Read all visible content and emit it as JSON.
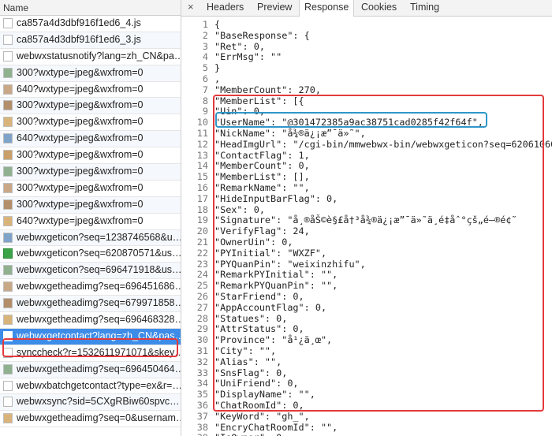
{
  "left_panel": {
    "header": "Name",
    "requests": [
      {
        "name": "ca857a4d3dbf916f1ed6_4.js",
        "icon": "file-icon"
      },
      {
        "name": "ca857a4d3dbf916f1ed6_3.js",
        "icon": "file-icon"
      },
      {
        "name": "webwxstatusnotify?lang=zh_CN&pa…",
        "icon": "file-icon"
      },
      {
        "name": "300?wxtype=jpeg&wxfrom=0",
        "icon": "image-icon"
      },
      {
        "name": "640?wxtype=jpeg&wxfrom=0",
        "icon": "image-icon"
      },
      {
        "name": "300?wxtype=jpeg&wxfrom=0",
        "icon": "image-icon"
      },
      {
        "name": "300?wxtype=jpeg&wxfrom=0",
        "icon": "image-icon"
      },
      {
        "name": "640?wxtype=jpeg&wxfrom=0",
        "icon": "image-icon"
      },
      {
        "name": "300?wxtype=jpeg&wxfrom=0",
        "icon": "image-icon"
      },
      {
        "name": "300?wxtype=jpeg&wxfrom=0",
        "icon": "image-icon"
      },
      {
        "name": "300?wxtype=jpeg&wxfrom=0",
        "icon": "image-icon"
      },
      {
        "name": "300?wxtype=jpeg&wxfrom=0",
        "icon": "image-icon"
      },
      {
        "name": "640?wxtype=jpeg&wxfrom=0",
        "icon": "image-icon"
      },
      {
        "name": "webwxgeticon?seq=1238746568&u…",
        "icon": "image-icon"
      },
      {
        "name": "webwxgeticon?seq=620870571&us…",
        "icon": "image-icon-green"
      },
      {
        "name": "webwxgeticon?seq=696471918&us…",
        "icon": "image-icon"
      },
      {
        "name": "webwxgetheadimg?seq=696451686…",
        "icon": "image-icon"
      },
      {
        "name": "webwxgetheadimg?seq=679971858…",
        "icon": "image-icon"
      },
      {
        "name": "webwxgetheadimg?seq=696468328…",
        "icon": "image-icon"
      },
      {
        "name": "webwxgetcontact?lang=zh_CN&pas…",
        "icon": "file-icon",
        "selected": true
      },
      {
        "name": "synccheck?r=1532611971071&skey…",
        "icon": "file-icon"
      },
      {
        "name": "webwxgetheadimg?seq=696450464…",
        "icon": "image-icon"
      },
      {
        "name": "webwxbatchgetcontact?type=ex&r=…",
        "icon": "file-icon"
      },
      {
        "name": "webwxsync?sid=5CXgRBiw60spvc…",
        "icon": "file-icon"
      },
      {
        "name": "webwxgetheadimg?seq=0&usernam…",
        "icon": "image-icon"
      }
    ]
  },
  "detail": {
    "close_icon": "×",
    "tabs": [
      "Headers",
      "Preview",
      "Response",
      "Cookies",
      "Timing"
    ],
    "active_tab": "Response",
    "lines": [
      {
        "n": "1",
        "t": "{"
      },
      {
        "n": "2",
        "t": "\"BaseResponse\": {"
      },
      {
        "n": "3",
        "t": "\"Ret\": 0,"
      },
      {
        "n": "4",
        "t": "\"ErrMsg\": \"\""
      },
      {
        "n": "5",
        "t": "}"
      },
      {
        "n": "6",
        "t": ","
      },
      {
        "n": "7",
        "t": "\"MemberCount\": 270,"
      },
      {
        "n": "8",
        "t": "\"MemberList\": [{"
      },
      {
        "n": "9",
        "t": "\"Uin\": 0,"
      },
      {
        "n": "10",
        "t": "\"UserName\": \"@301472385a9ac38751cad0285f42f64f\","
      },
      {
        "n": "11",
        "t": "\"NickName\": \"å¾®ä¿¡æ”¯ä»˜\","
      },
      {
        "n": "12",
        "t": "\"HeadImgUrl\": \"/cgi-bin/mmwebwx-bin/webwxgeticon?seq=620610606"
      },
      {
        "n": "13",
        "t": "\"ContactFlag\": 1,"
      },
      {
        "n": "14",
        "t": "\"MemberCount\": 0,"
      },
      {
        "n": "15",
        "t": "\"MemberList\": [],"
      },
      {
        "n": "16",
        "t": "\"RemarkName\": \"\","
      },
      {
        "n": "17",
        "t": "\"HideInputBarFlag\": 0,"
      },
      {
        "n": "18",
        "t": "\"Sex\": 0,"
      },
      {
        "n": "19",
        "t": "\"Signature\": \"å¸®åŠ©è§£å†³å¾®ä¿¡æ”¯ä»˜ä¸­é‡åˆ°çš„é—®é¢˜"
      },
      {
        "n": "20",
        "t": "\"VerifyFlag\": 24,"
      },
      {
        "n": "21",
        "t": "\"OwnerUin\": 0,"
      },
      {
        "n": "22",
        "t": "\"PYInitial\": \"WXZF\","
      },
      {
        "n": "23",
        "t": "\"PYQuanPin\": \"weixinzhifu\","
      },
      {
        "n": "24",
        "t": "\"RemarkPYInitial\": \"\","
      },
      {
        "n": "25",
        "t": "\"RemarkPYQuanPin\": \"\","
      },
      {
        "n": "26",
        "t": "\"StarFriend\": 0,"
      },
      {
        "n": "27",
        "t": "\"AppAccountFlag\": 0,"
      },
      {
        "n": "28",
        "t": "\"Statues\": 0,"
      },
      {
        "n": "29",
        "t": "\"AttrStatus\": 0,"
      },
      {
        "n": "30",
        "t": "\"Province\": \"å¹¿ä¸œ\","
      },
      {
        "n": "31",
        "t": "\"City\": \"\","
      },
      {
        "n": "32",
        "t": "\"Alias\": \"\","
      },
      {
        "n": "33",
        "t": "\"SnsFlag\": 0,"
      },
      {
        "n": "34",
        "t": "\"UniFriend\": 0,"
      },
      {
        "n": "35",
        "t": "\"DisplayName\": \"\","
      },
      {
        "n": "36",
        "t": "\"ChatRoomId\": 0,"
      },
      {
        "n": "37",
        "t": "\"KeyWord\": \"gh_\","
      },
      {
        "n": "38",
        "t": "\"EncryChatRoomId\": \"\","
      },
      {
        "n": "39",
        "t": "\"IsOwner\": 0,"
      }
    ]
  },
  "colors": {
    "annotation_red": "#e33a3d",
    "annotation_blue": "#2f97c9",
    "selected_row": "#3d8ce8"
  }
}
